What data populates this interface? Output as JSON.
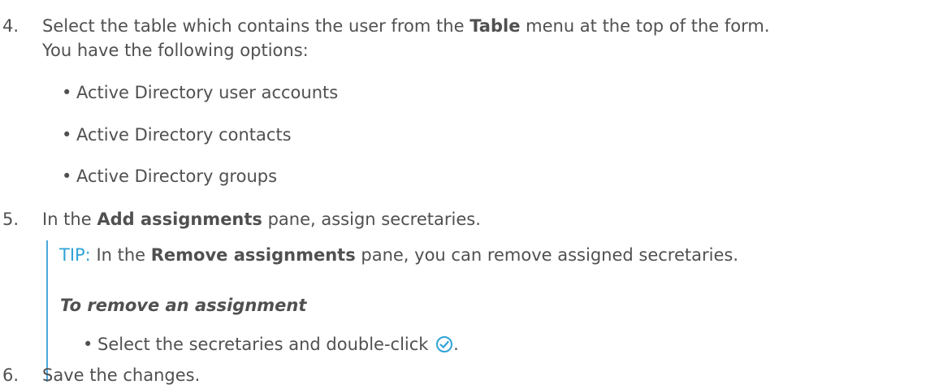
{
  "steps": {
    "s4": {
      "num": "4.",
      "pre": "Select the table which contains the user from the ",
      "bold": "Table",
      "post": " menu at the top of the form.",
      "line2": "You have the following options:",
      "options": [
        "Active Directory user accounts",
        "Active Directory contacts",
        "Active Directory groups"
      ]
    },
    "s5": {
      "num": "5.",
      "pre": "In the ",
      "bold": "Add assignments",
      "post": " pane, assign secretaries."
    },
    "tip": {
      "label": "TIP:",
      "pre": " In the ",
      "bold": "Remove assignments",
      "post": " pane, you can remove assigned secretaries.",
      "heading": "To remove an assignment",
      "bullet": "Select the secretaries and double-click ",
      "bullet_end": "."
    },
    "s6": {
      "num": "6.",
      "text": "Save the changes."
    }
  },
  "colors": {
    "text": "#505050",
    "tip_accent": "#2fa3d6",
    "tip_bar": "#4aa8de",
    "check_icon": "#2fa3d6"
  },
  "icons": {
    "confirm": "check-circle-icon"
  }
}
